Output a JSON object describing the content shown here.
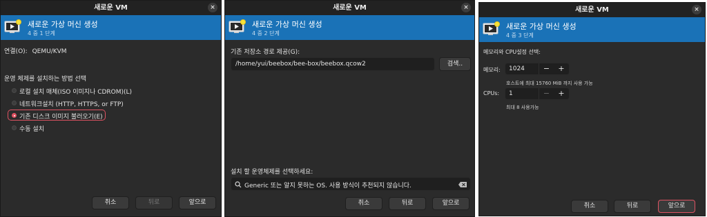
{
  "common": {
    "window_title": "새로운 VM",
    "close_glyph": "×",
    "banner_title": "새로운 가상 머신 생성",
    "cancel_label": "취소",
    "back_label": "뒤로",
    "forward_label": "앞으로",
    "accent_color": "#1a72b7",
    "focus_color": "#e05363"
  },
  "step1": {
    "step_text": "4 중 1 단계",
    "connection_label": "연결(O):",
    "connection_value": "QEMU/KVM",
    "install_heading": "운영 체제를 설치하는 방법 선택",
    "options": [
      {
        "label": "로컬 설치 매체(ISO 이미지나 CDROM)(L)",
        "selected": false
      },
      {
        "label": "네트워크설치 (HTTP, HTTPS, or FTP)",
        "selected": false
      },
      {
        "label": "기존 디스크 이미지 불러오기(E)",
        "selected": true
      },
      {
        "label": "수동 설치",
        "selected": false
      }
    ]
  },
  "step2": {
    "step_text": "4 중 2 단계",
    "storage_label": "기존 저장소 경로 제공(G):",
    "storage_path": "/home/yui/beebox/bee-box/beebox.qcow2",
    "browse_label": "검색..",
    "os_label": "설치 할 운영체제를 선택하세요:",
    "os_search_value": "Generic 또는 알지 못하는 OS. 사용 방식이 추천되지 않습니다.",
    "search_icon": "search-icon",
    "clear_icon": "clear-icon"
  },
  "step3": {
    "step_text": "4 중 3 단계",
    "heading": "메모리와 CPU설정 선택:",
    "memory_label": "메모리:",
    "memory_value": "1024",
    "memory_hint": "호스트에 최대 15760 MiB 까지 사용 가능",
    "cpu_label": "CPUs:",
    "cpu_value": "1",
    "cpu_hint": "최대 8 사용가능",
    "minus_glyph": "−",
    "plus_glyph": "+"
  }
}
